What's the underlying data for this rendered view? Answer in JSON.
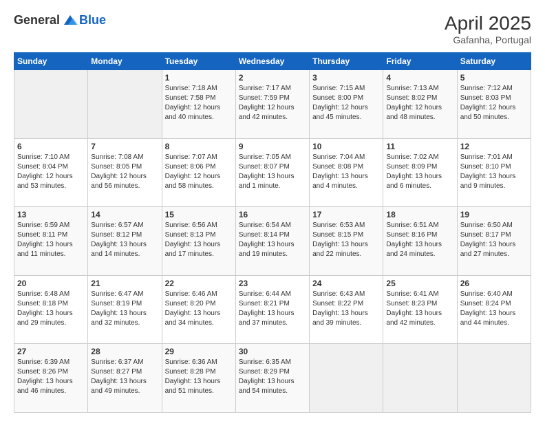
{
  "logo": {
    "general": "General",
    "blue": "Blue"
  },
  "header": {
    "month_year": "April 2025",
    "location": "Gafanha, Portugal"
  },
  "weekdays": [
    "Sunday",
    "Monday",
    "Tuesday",
    "Wednesday",
    "Thursday",
    "Friday",
    "Saturday"
  ],
  "weeks": [
    [
      {
        "day": "",
        "detail": ""
      },
      {
        "day": "",
        "detail": ""
      },
      {
        "day": "1",
        "detail": "Sunrise: 7:18 AM\nSunset: 7:58 PM\nDaylight: 12 hours and 40 minutes."
      },
      {
        "day": "2",
        "detail": "Sunrise: 7:17 AM\nSunset: 7:59 PM\nDaylight: 12 hours and 42 minutes."
      },
      {
        "day": "3",
        "detail": "Sunrise: 7:15 AM\nSunset: 8:00 PM\nDaylight: 12 hours and 45 minutes."
      },
      {
        "day": "4",
        "detail": "Sunrise: 7:13 AM\nSunset: 8:02 PM\nDaylight: 12 hours and 48 minutes."
      },
      {
        "day": "5",
        "detail": "Sunrise: 7:12 AM\nSunset: 8:03 PM\nDaylight: 12 hours and 50 minutes."
      }
    ],
    [
      {
        "day": "6",
        "detail": "Sunrise: 7:10 AM\nSunset: 8:04 PM\nDaylight: 12 hours and 53 minutes."
      },
      {
        "day": "7",
        "detail": "Sunrise: 7:08 AM\nSunset: 8:05 PM\nDaylight: 12 hours and 56 minutes."
      },
      {
        "day": "8",
        "detail": "Sunrise: 7:07 AM\nSunset: 8:06 PM\nDaylight: 12 hours and 58 minutes."
      },
      {
        "day": "9",
        "detail": "Sunrise: 7:05 AM\nSunset: 8:07 PM\nDaylight: 13 hours and 1 minute."
      },
      {
        "day": "10",
        "detail": "Sunrise: 7:04 AM\nSunset: 8:08 PM\nDaylight: 13 hours and 4 minutes."
      },
      {
        "day": "11",
        "detail": "Sunrise: 7:02 AM\nSunset: 8:09 PM\nDaylight: 13 hours and 6 minutes."
      },
      {
        "day": "12",
        "detail": "Sunrise: 7:01 AM\nSunset: 8:10 PM\nDaylight: 13 hours and 9 minutes."
      }
    ],
    [
      {
        "day": "13",
        "detail": "Sunrise: 6:59 AM\nSunset: 8:11 PM\nDaylight: 13 hours and 11 minutes."
      },
      {
        "day": "14",
        "detail": "Sunrise: 6:57 AM\nSunset: 8:12 PM\nDaylight: 13 hours and 14 minutes."
      },
      {
        "day": "15",
        "detail": "Sunrise: 6:56 AM\nSunset: 8:13 PM\nDaylight: 13 hours and 17 minutes."
      },
      {
        "day": "16",
        "detail": "Sunrise: 6:54 AM\nSunset: 8:14 PM\nDaylight: 13 hours and 19 minutes."
      },
      {
        "day": "17",
        "detail": "Sunrise: 6:53 AM\nSunset: 8:15 PM\nDaylight: 13 hours and 22 minutes."
      },
      {
        "day": "18",
        "detail": "Sunrise: 6:51 AM\nSunset: 8:16 PM\nDaylight: 13 hours and 24 minutes."
      },
      {
        "day": "19",
        "detail": "Sunrise: 6:50 AM\nSunset: 8:17 PM\nDaylight: 13 hours and 27 minutes."
      }
    ],
    [
      {
        "day": "20",
        "detail": "Sunrise: 6:48 AM\nSunset: 8:18 PM\nDaylight: 13 hours and 29 minutes."
      },
      {
        "day": "21",
        "detail": "Sunrise: 6:47 AM\nSunset: 8:19 PM\nDaylight: 13 hours and 32 minutes."
      },
      {
        "day": "22",
        "detail": "Sunrise: 6:46 AM\nSunset: 8:20 PM\nDaylight: 13 hours and 34 minutes."
      },
      {
        "day": "23",
        "detail": "Sunrise: 6:44 AM\nSunset: 8:21 PM\nDaylight: 13 hours and 37 minutes."
      },
      {
        "day": "24",
        "detail": "Sunrise: 6:43 AM\nSunset: 8:22 PM\nDaylight: 13 hours and 39 minutes."
      },
      {
        "day": "25",
        "detail": "Sunrise: 6:41 AM\nSunset: 8:23 PM\nDaylight: 13 hours and 42 minutes."
      },
      {
        "day": "26",
        "detail": "Sunrise: 6:40 AM\nSunset: 8:24 PM\nDaylight: 13 hours and 44 minutes."
      }
    ],
    [
      {
        "day": "27",
        "detail": "Sunrise: 6:39 AM\nSunset: 8:26 PM\nDaylight: 13 hours and 46 minutes."
      },
      {
        "day": "28",
        "detail": "Sunrise: 6:37 AM\nSunset: 8:27 PM\nDaylight: 13 hours and 49 minutes."
      },
      {
        "day": "29",
        "detail": "Sunrise: 6:36 AM\nSunset: 8:28 PM\nDaylight: 13 hours and 51 minutes."
      },
      {
        "day": "30",
        "detail": "Sunrise: 6:35 AM\nSunset: 8:29 PM\nDaylight: 13 hours and 54 minutes."
      },
      {
        "day": "",
        "detail": ""
      },
      {
        "day": "",
        "detail": ""
      },
      {
        "day": "",
        "detail": ""
      }
    ]
  ]
}
